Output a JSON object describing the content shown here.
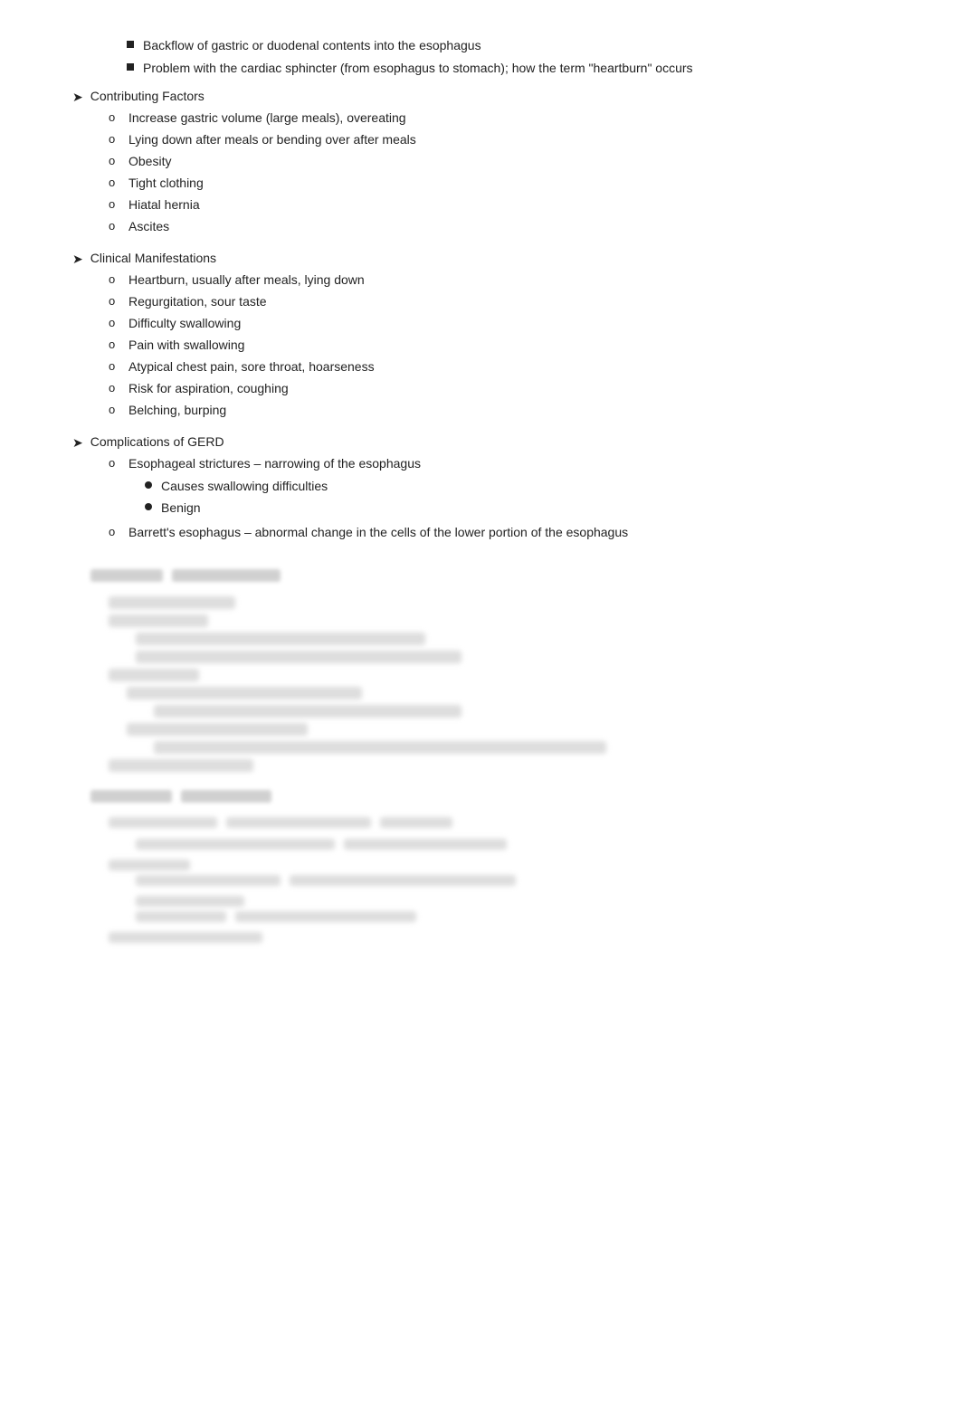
{
  "page": {
    "bullet_items": [
      "Backflow of gastric or duodenal contents into the esophagus",
      "Problem with the cardiac sphincter (from esophagus to stomach); how the term \"heartburn\" occurs"
    ],
    "sections": [
      {
        "heading": "Contributing Factors",
        "items": [
          "Increase gastric volume (large meals), overeating",
          "Lying down after meals or bending over after meals",
          "Obesity",
          "Tight clothing",
          "Hiatal hernia",
          "Ascites"
        ]
      },
      {
        "heading": "Clinical Manifestations",
        "items": [
          "Heartburn, usually after meals, lying down",
          "Regurgitation, sour taste",
          "Difficulty swallowing",
          "Pain with swallowing",
          "Atypical chest pain, sore throat, hoarseness",
          "Risk for aspiration, coughing",
          "Belching, burping"
        ]
      },
      {
        "heading": "Complications of GERD",
        "items": [
          {
            "text": "Esophageal strictures – narrowing of the esophagus",
            "sub_items": [
              "Causes swallowing difficulties",
              "Benign"
            ]
          },
          {
            "text": "Barrett's esophagus – abnormal change in the cells of the lower portion of the esophagus",
            "sub_items": []
          }
        ]
      }
    ],
    "arrow_symbol": "➤",
    "circle_symbol": "o"
  }
}
